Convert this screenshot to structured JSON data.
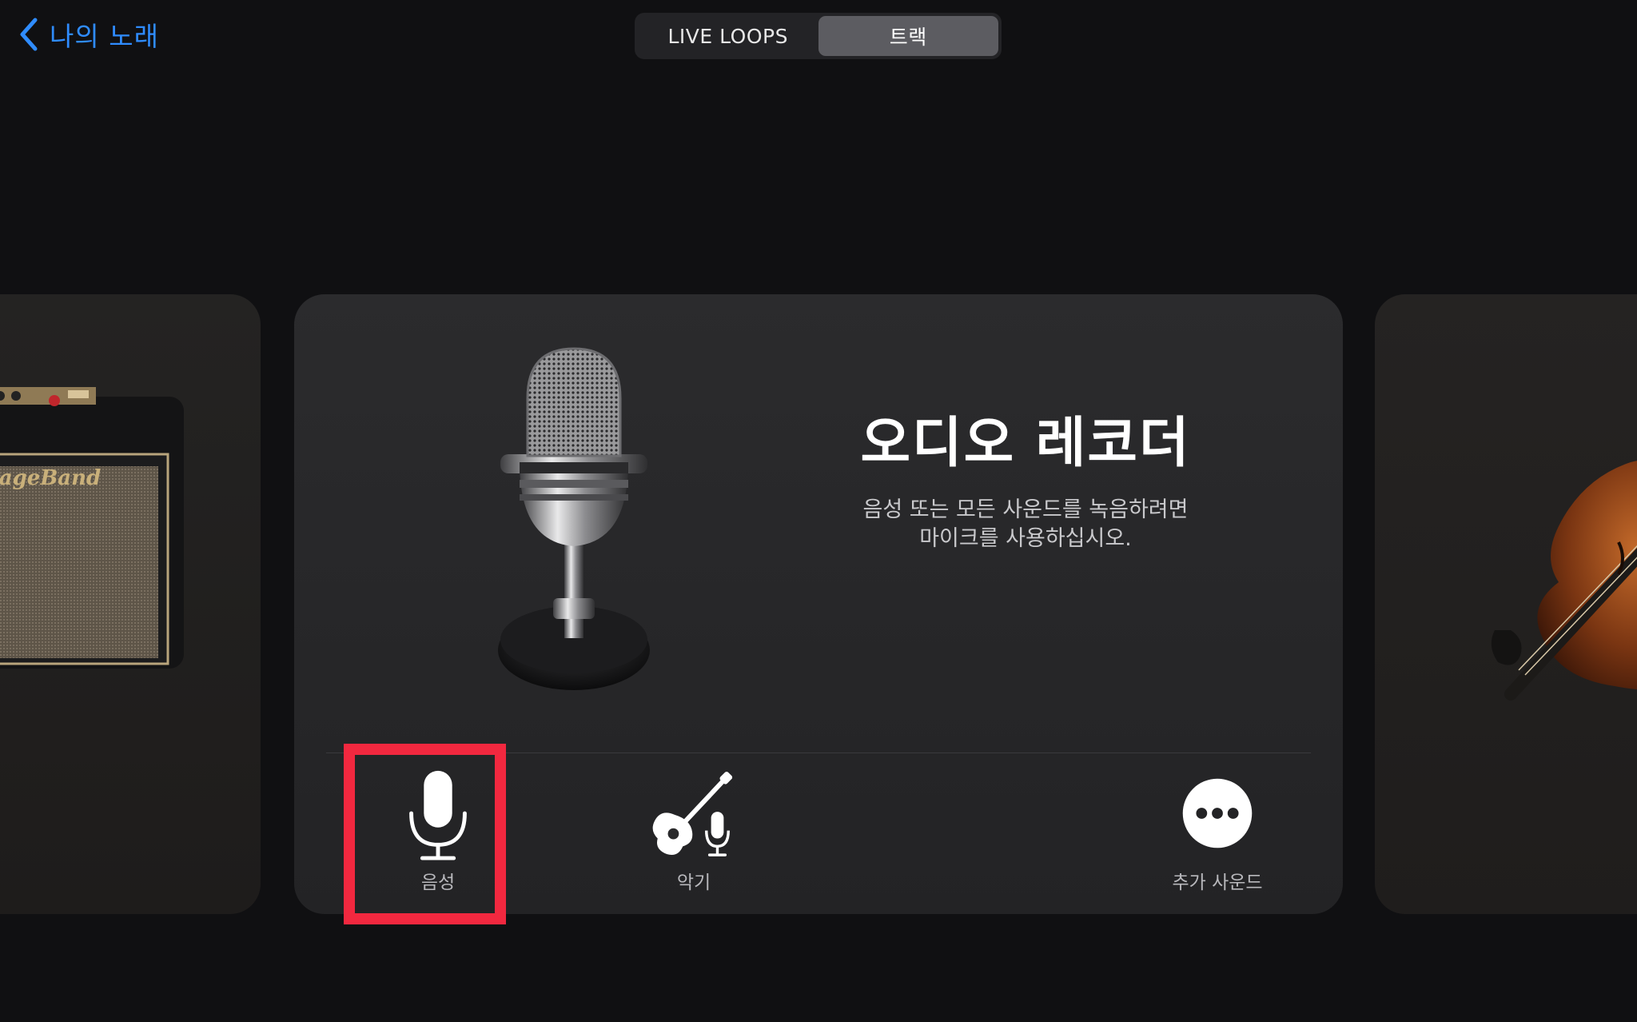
{
  "nav": {
    "back_label": "나의 노래"
  },
  "segmented_control": {
    "options": [
      "LIVE LOOPS",
      "트랙"
    ],
    "selected": "트랙"
  },
  "card": {
    "title": "오디오 레코더",
    "description_line1": "음성 또는 모든 사운드를 녹음하려면",
    "description_line2": "마이크를 사용하십시오.",
    "options": [
      {
        "label": "음성",
        "icon": "microphone-icon"
      },
      {
        "label": "악기",
        "icon": "guitar-microphone-icon"
      },
      {
        "label": "추가 사운드",
        "icon": "more-icon"
      }
    ]
  },
  "side_cards": {
    "left_icon": "guitar-amp-image",
    "right_icon": "violin-image"
  },
  "colors": {
    "accent_blue": "#2f8cff",
    "highlight_red": "#f2283f",
    "background": "#101012"
  }
}
